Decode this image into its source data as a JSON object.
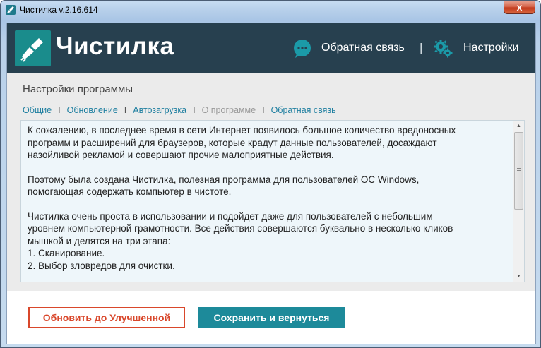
{
  "window": {
    "title": "Чистилка v.2.16.614",
    "close_label": "x"
  },
  "header": {
    "logo_text": "Чистилка",
    "feedback_label": "Обратная связь",
    "separator": "|",
    "settings_label": "Настройки",
    "icons": [
      "broom-icon",
      "chat-bubble-icon",
      "gear-icon"
    ]
  },
  "settings": {
    "title": "Настройки программы",
    "tabs": [
      {
        "label": "Общие",
        "enabled": true
      },
      {
        "label": "Обновление",
        "enabled": true
      },
      {
        "label": "Автозагрузка",
        "enabled": true
      },
      {
        "label": "О программе",
        "enabled": false
      },
      {
        "label": "Обратная связь",
        "enabled": true
      }
    ],
    "tab_separator": "I",
    "about_text": {
      "paragraph1": [
        "К сожалению, в последнее время в сети Интернет появилось большое количество вредоносных",
        "программ и расширений для браузеров, которые крадут данные пользователей, досаждают",
        "назойливой рекламой и совершают прочие малоприятные действия."
      ],
      "paragraph2": [
        "Поэтому была создана Чистилка, полезная программа для пользователей ОС Windows,",
        "помогающая содержать компьютер в чистоте."
      ],
      "paragraph3": [
        "Чистилка очень проста в использовании и подойдет даже для пользователей с небольшим",
        "уровнем компьютерной грамотности. Все действия совершаются буквально в несколько кликов",
        "мышкой и делятся на три этапа:",
        "1. Сканирование.",
        "2. Выбор зловредов для очистки."
      ]
    }
  },
  "footer": {
    "upgrade_label": "Обновить до Улучшенной",
    "save_label": "Сохранить и вернуться"
  },
  "colors": {
    "header_bg": "#27404f",
    "accent_teal": "#1d8a9a",
    "upgrade_red": "#d9472b",
    "link_blue": "#1f7fa0",
    "panel_bg": "#ebebeb"
  }
}
